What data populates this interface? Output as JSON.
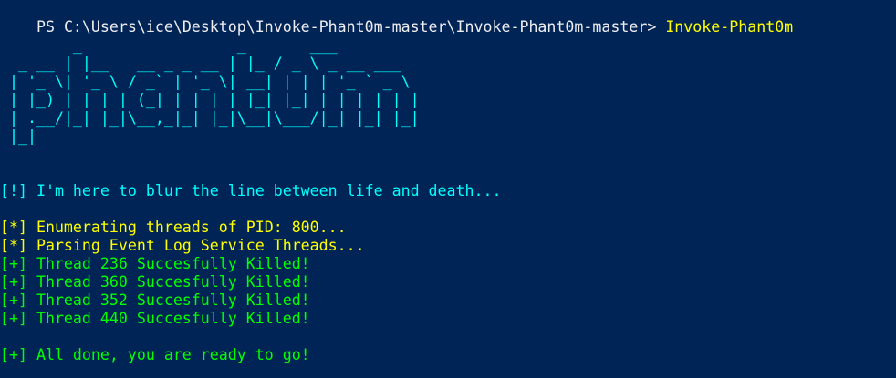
{
  "window": {
    "app": "Windows PowerShell console"
  },
  "colors": {
    "background": "#012456",
    "prompt": "#EEEDF0",
    "command": "#FFFF00",
    "banner": "#00FFFF",
    "info": "#00FFFF",
    "warning": "#FFFF00",
    "success": "#00FF00"
  },
  "console": {
    "prompt": {
      "path": "PS C:\\Users\\ice\\Desktop\\Invoke-Phant0m-master\\Invoke-Phant0m-master> ",
      "command": "Invoke-Phant0m"
    },
    "banner": [
      "        _                 _       ___",
      "  _ __ | |__   __ _ _ __ | |_ / _ \\ _ __ ___",
      " | '_ \\| '_ \\ / _` | '_ \\| __| | | | '_ ` _ \\",
      " | |_) | | | | (_| | | | | |_| |_| | | | | | |",
      " | .__/|_| |_|\\__,_|_| |_|\\__|\\___/|_| |_| |_|",
      " |_|"
    ],
    "tagline": "[!] I'm here to blur the line between life and death...",
    "status": [
      "[*] Enumerating threads of PID: 800...",
      "[*] Parsing Event Log Service Threads..."
    ],
    "killed": [
      "[+] Thread 236 Succesfully Killed!",
      "[+] Thread 360 Succesfully Killed!",
      "[+] Thread 352 Succesfully Killed!",
      "[+] Thread 440 Succesfully Killed!"
    ],
    "done": "[+] All done, you are ready to go!"
  }
}
